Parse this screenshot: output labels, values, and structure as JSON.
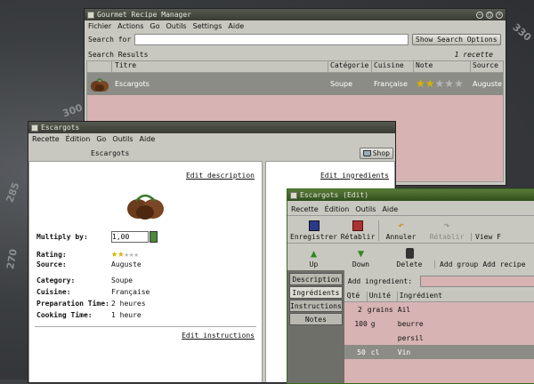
{
  "background": {
    "dial_labels": [
      "300",
      "270",
      "285",
      "330"
    ]
  },
  "main_window": {
    "title": "Gourmet Recipe Manager",
    "menu": [
      "Fichier",
      "Actions",
      "Go",
      "Outils",
      "Settings",
      "Aide"
    ],
    "search_label": "Search for",
    "search_value": "",
    "search_options_button": "Show Search Options",
    "results_label": "Search Results",
    "results_count": "1 recette",
    "columns": [
      "Titre",
      "Catégorie",
      "Cuisine",
      "Note",
      "Source"
    ],
    "rows": [
      {
        "title": "Escargots",
        "category": "Soupe",
        "cuisine": "Française",
        "rating": 2,
        "source": "Auguste"
      }
    ]
  },
  "recipe_window": {
    "title": "Escargots",
    "menu": [
      "Recette",
      "Édition",
      "Go",
      "Outils",
      "Aide"
    ],
    "heading": "Escargots",
    "shop_button": "Shop",
    "edit_description": "Edit description",
    "edit_ingredients": "Edit ingredients",
    "edit_instructions": "Edit instructions",
    "multiply_label": "Multiply by:",
    "multiply_value": "1,00",
    "rating_label": "Rating:",
    "rating_value": 2,
    "fields": [
      {
        "label": "Source:",
        "value": "Auguste"
      },
      {
        "label": "Category:",
        "value": "Soupe"
      },
      {
        "label": "Cuisine:",
        "value": "Française"
      },
      {
        "label": "Preparation Time:",
        "value": "2 heures"
      },
      {
        "label": "Cooking Time:",
        "value": "1 heure"
      }
    ]
  },
  "edit_window": {
    "title": "Escargots (Edit)",
    "menu": [
      "Recette",
      "Édition",
      "Outils",
      "Aide"
    ],
    "toolbar1": [
      "Enregistrer",
      "Rétablir",
      "Annuler",
      "Rétablir",
      "View F"
    ],
    "toolbar2": [
      "Up",
      "Down",
      "Delete",
      "Add group",
      "Add recipe"
    ],
    "tabs": [
      "Description",
      "Ingrédients",
      "Instructions",
      "Notes"
    ],
    "add_ingredient_label": "Add ingredient:",
    "add_ingredient_value": "",
    "columns": [
      "Qté",
      "Unité",
      "Ingrédient"
    ],
    "rows": [
      {
        "qty": "2",
        "unit": "grains",
        "name": "Ail"
      },
      {
        "qty": "100",
        "unit": "g",
        "name": "beurre"
      },
      {
        "qty": "",
        "unit": "",
        "name": "persil"
      },
      {
        "qty": "50",
        "unit": "cl",
        "name": "Vin"
      }
    ]
  }
}
